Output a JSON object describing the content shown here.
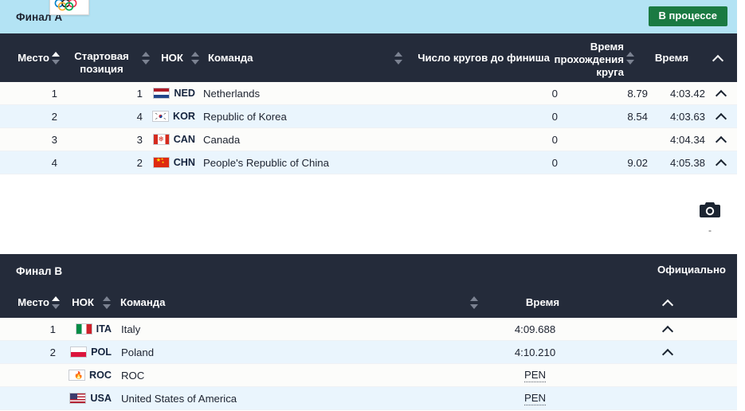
{
  "final_a": {
    "banner_title": "Финал A",
    "status_label": "В процессе",
    "rings_icon": "olympic-rings-icon",
    "columns": [
      {
        "label": "Место",
        "sortable": true,
        "sort_state": "asc"
      },
      {
        "label": "Стартовая позиция",
        "sortable": true,
        "sort_state": "none"
      },
      {
        "label": "НОК",
        "sortable": true,
        "sort_state": "none"
      },
      {
        "label": "Команда",
        "sortable": true,
        "sort_state": "none"
      },
      {
        "label": "Число кругов до финиша",
        "sortable": false,
        "sort_state": "none"
      },
      {
        "label": "Время прохождения круга",
        "sortable": true,
        "sort_state": "none"
      },
      {
        "label": "Время",
        "sortable": false,
        "sort_state": "none"
      }
    ],
    "rows": [
      {
        "place": "1",
        "start_position": "1",
        "noc": "NED",
        "flag": "flag-netherlands",
        "team": "Netherlands",
        "laps_to_finish": "0",
        "lap_time": "8.79",
        "time": "4:03.42",
        "expand": "chevron-up-icon"
      },
      {
        "place": "2",
        "start_position": "4",
        "noc": "KOR",
        "flag": "flag-south-korea",
        "team": "Republic of Korea",
        "laps_to_finish": "0",
        "lap_time": "8.54",
        "time": "4:03.63",
        "expand": "chevron-up-icon"
      },
      {
        "place": "3",
        "start_position": "3",
        "noc": "CAN",
        "flag": "flag-canada",
        "team": "Canada",
        "laps_to_finish": "0",
        "lap_time": "",
        "time": "4:04.34",
        "expand": "chevron-up-icon"
      },
      {
        "place": "4",
        "start_position": "2",
        "noc": "CHN",
        "flag": "flag-china",
        "team": "People's Republic of China",
        "laps_to_finish": "0",
        "lap_time": "9.02",
        "time": "4:05.38",
        "expand": "chevron-up-icon"
      }
    ]
  },
  "camera": {
    "icon": "camera-icon",
    "caption": "-"
  },
  "final_b": {
    "banner_title": "Финал B",
    "status_label": "Официально",
    "columns": [
      {
        "label": "Место",
        "sortable": true,
        "sort_state": "asc"
      },
      {
        "label": "НОК",
        "sortable": true,
        "sort_state": "none"
      },
      {
        "label": "Команда",
        "sortable": true,
        "sort_state": "none"
      },
      {
        "label": "Время",
        "sortable": false,
        "sort_state": "none"
      }
    ],
    "rows": [
      {
        "place": "1",
        "noc": "ITA",
        "flag": "flag-italy",
        "team": "Italy",
        "time": "4:09.688",
        "time_abbr": false,
        "expand": "chevron-up-icon"
      },
      {
        "place": "2",
        "noc": "POL",
        "flag": "flag-poland",
        "team": "Poland",
        "time": "4:10.210",
        "time_abbr": false,
        "expand": "chevron-up-icon"
      },
      {
        "place": "",
        "noc": "ROC",
        "flag": "flag-roc",
        "team": "ROC",
        "time": "PEN",
        "time_abbr": true,
        "expand": ""
      },
      {
        "place": "",
        "noc": "USA",
        "flag": "flag-usa",
        "team": "United States of America",
        "time": "PEN",
        "time_abbr": true,
        "expand": ""
      }
    ]
  },
  "colors": {
    "banner_light": "#b3e3f4",
    "header_dark": "#242b3a",
    "status_green": "#1a7a42",
    "row_odd": "#fcfcfa",
    "row_even": "#eaf5fd"
  }
}
